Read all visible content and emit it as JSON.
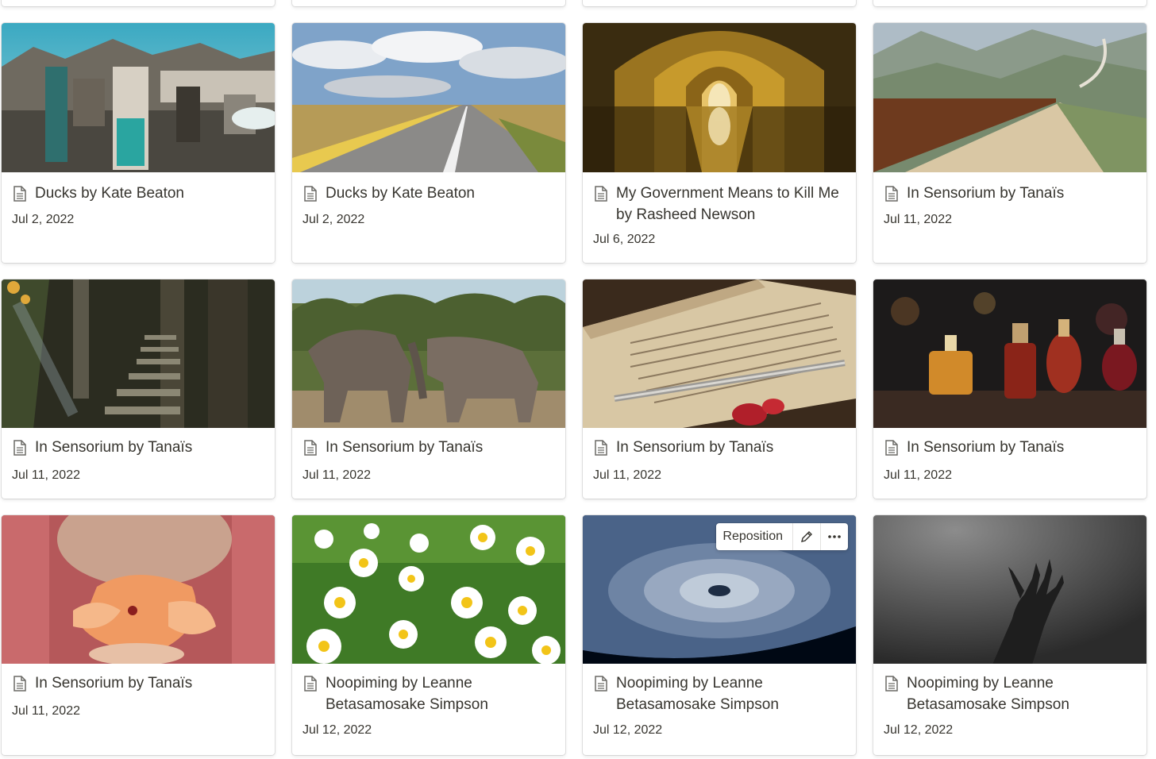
{
  "cards": [
    {
      "title": "Ducks by Kate Beaton",
      "date": "Jul 2, 2022",
      "cover": "miners-cover"
    },
    {
      "title": "Ducks by Kate Beaton",
      "date": "Jul 2, 2022",
      "cover": "road-cover"
    },
    {
      "title": "My Government Means to Kill Me by Rasheed Newson",
      "date": "Jul 6, 2022",
      "cover": "arches-cover"
    },
    {
      "title": "In Sensorium by Tanaïs",
      "date": "Jul 11, 2022",
      "cover": "border-wall-cover"
    },
    {
      "title": "In Sensorium by Tanaïs",
      "date": "Jul 11, 2022",
      "cover": "forest-stairs-cover"
    },
    {
      "title": "In Sensorium by Tanaïs",
      "date": "Jul 11, 2022",
      "cover": "elephants-cover"
    },
    {
      "title": "In Sensorium by Tanaïs",
      "date": "Jul 11, 2022",
      "cover": "book-pen-cover"
    },
    {
      "title": "In Sensorium by Tanaïs",
      "date": "Jul 11, 2022",
      "cover": "perfume-bottles-cover"
    },
    {
      "title": "In Sensorium by Tanaïs",
      "date": "Jul 11, 2022",
      "cover": "flower-smell-cover"
    },
    {
      "title": "Noopiming by Leanne Betasamosake Simpson",
      "date": "Jul 12, 2022",
      "cover": "daisies-cover"
    },
    {
      "title": "Noopiming by Leanne Betasamosake Simpson",
      "date": "Jul 12, 2022",
      "cover": "hurricane-cover"
    },
    {
      "title": "Noopiming by Leanne Betasamosake Simpson",
      "date": "Jul 12, 2022",
      "cover": "underwater-hand-cover"
    }
  ],
  "cover_menu": {
    "reposition_label": "Reposition",
    "edit_icon": "pencil-icon",
    "more_icon": "more-icon"
  },
  "icons": {
    "page": "page-icon"
  }
}
